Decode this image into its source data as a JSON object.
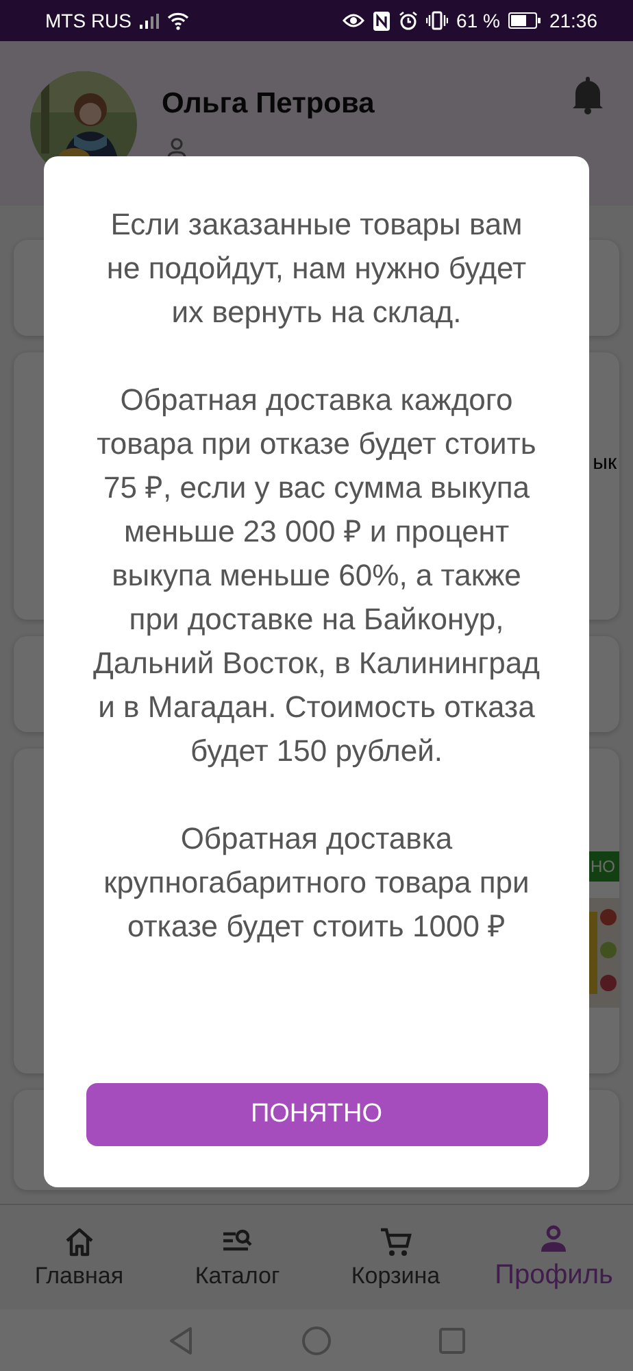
{
  "status_bar": {
    "carrier": "MTS RUS",
    "battery_percent": "61 %",
    "time": "21:36"
  },
  "profile": {
    "name": "Ольга Петрова"
  },
  "background_fragments": {
    "card_text": "ык",
    "badge": "НО"
  },
  "dialog": {
    "paragraphs": [
      "Если заказанные товары вам не подойдут, нам нужно будет их вернуть на склад.",
      "Обратная доставка каждого товара при отказе будет стоить 75 ₽, если у вас сумма выкупа меньше 23 000 ₽ и процент выкупа меньше 60%, а также при доставке на Байконур, Дальний Восток, в Калининград и в Магадан. Стоимость отказа будет 150 рублей.",
      "Обратная доставка крупногабаритного товара при отказе будет стоить 1000 ₽"
    ],
    "button": "ПОНЯТНО"
  },
  "nav": [
    {
      "kind": "home",
      "label": "Главная",
      "selected": false
    },
    {
      "kind": "catalog",
      "label": "Каталог",
      "selected": false
    },
    {
      "kind": "cart",
      "label": "Корзина",
      "selected": false
    },
    {
      "kind": "profile",
      "label": "Профиль",
      "selected": true
    }
  ]
}
